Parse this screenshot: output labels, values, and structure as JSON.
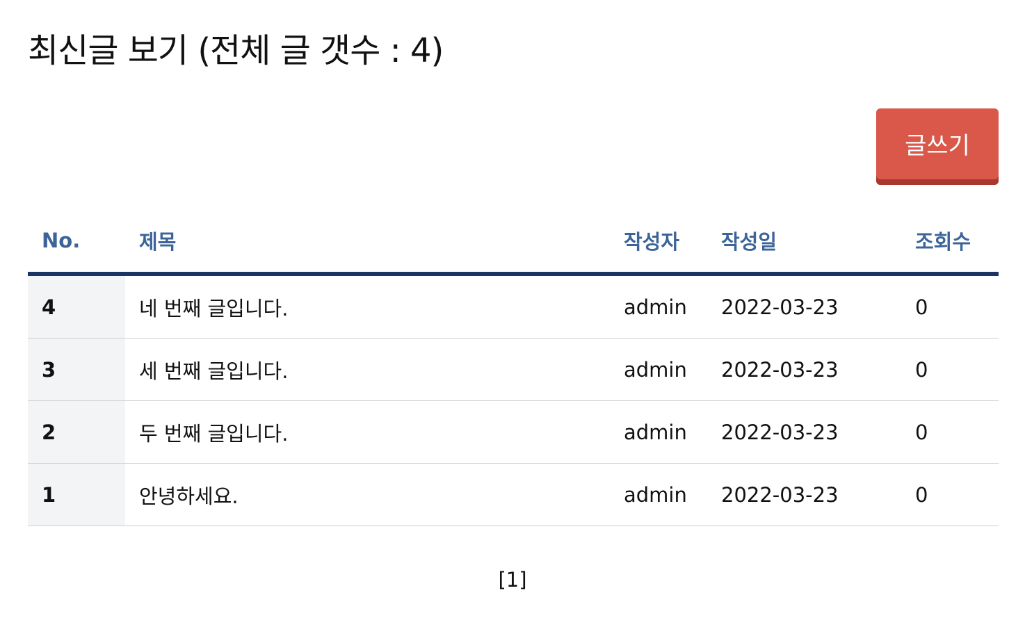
{
  "page": {
    "title": "최신글 보기 (전체 글 갯수 : 4)"
  },
  "toolbar": {
    "write_label": "글쓰기"
  },
  "table": {
    "headers": {
      "no": "No.",
      "title": "제목",
      "writer": "작성자",
      "date": "작성일",
      "views": "조회수"
    },
    "rows": [
      {
        "no": "4",
        "title": "네 번째 글입니다.",
        "writer": "admin",
        "date": "2022-03-23",
        "views": "0"
      },
      {
        "no": "3",
        "title": "세 번째 글입니다.",
        "writer": "admin",
        "date": "2022-03-23",
        "views": "0"
      },
      {
        "no": "2",
        "title": "두 번째 글입니다.",
        "writer": "admin",
        "date": "2022-03-23",
        "views": "0"
      },
      {
        "no": "1",
        "title": "안녕하세요.",
        "writer": "admin",
        "date": "2022-03-23",
        "views": "0"
      }
    ]
  },
  "pagination": {
    "pages": [
      "[1]"
    ]
  },
  "colors": {
    "accent": "#d9584a",
    "header_text": "#3c6499",
    "header_rule": "#1a3563"
  }
}
